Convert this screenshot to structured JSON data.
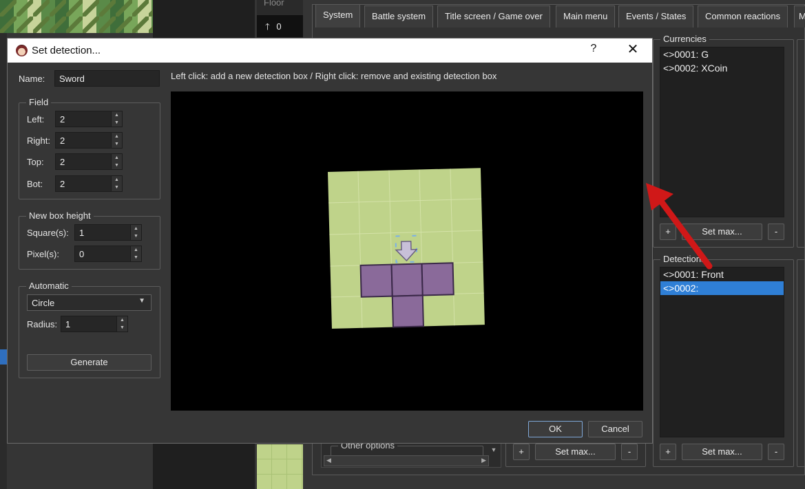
{
  "background_app": {
    "floor_label": "Floor",
    "floor_count": "0",
    "tabs": [
      {
        "label": "System",
        "active": true
      },
      {
        "label": "Battle system",
        "active": false
      },
      {
        "label": "Title screen / Game over",
        "active": false
      },
      {
        "label": "Main menu",
        "active": false
      },
      {
        "label": "Events / States",
        "active": false
      },
      {
        "label": "Common reactions",
        "active": false
      },
      {
        "label": "M",
        "active": false
      }
    ],
    "currencies": {
      "title": "Currencies",
      "items": [
        "<>0001: G",
        "<>0002: XCoin"
      ],
      "add_label": "+",
      "setmax_label": "Set max...",
      "remove_label": "-"
    },
    "detections": {
      "title": "Detections",
      "items": [
        {
          "label": "<>0001: Front",
          "selected": false
        },
        {
          "label": "<>0002:",
          "selected": true
        }
      ],
      "add_label": "+",
      "setmax_label": "Set max...",
      "remove_label": "-"
    },
    "other_options_title": "Other options",
    "middle_buttons": {
      "add_label": "+",
      "setmax_label": "Set max...",
      "remove_label": "-"
    }
  },
  "dialog": {
    "title": "Set detection...",
    "help_label": "?",
    "close_label": "✕",
    "name_label": "Name:",
    "name_value": "Sword",
    "instruction": "Left click: add a new detection box  / Right click: remove and existing detection box",
    "field": {
      "title": "Field",
      "rows": [
        {
          "label": "Left:",
          "value": "2"
        },
        {
          "label": "Right:",
          "value": "2"
        },
        {
          "label": "Top:",
          "value": "2"
        },
        {
          "label": "Bot:",
          "value": "2"
        }
      ]
    },
    "new_box_height": {
      "title": "New box height",
      "rows": [
        {
          "label": "Square(s):",
          "value": "1"
        },
        {
          "label": "Pixel(s):",
          "value": "0"
        }
      ]
    },
    "automatic": {
      "title": "Automatic",
      "shape_value": "Circle",
      "radius_label": "Radius:",
      "radius_value": "1",
      "generate_label": "Generate"
    },
    "ok_label": "OK",
    "cancel_label": "Cancel"
  },
  "colors": {
    "accent": "#2f7fd6",
    "grid_fill": "#bfd38a",
    "box_fill": "#8a6a9a",
    "annotation_arrow": "#d01818"
  }
}
